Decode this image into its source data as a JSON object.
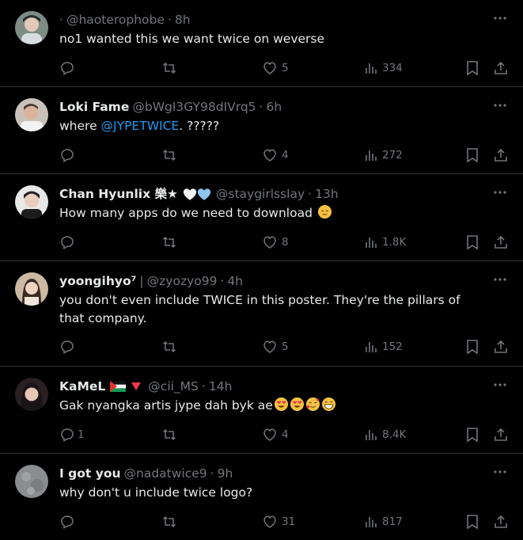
{
  "tweets": [
    {
      "name": "",
      "prefix": "⋅",
      "handle": "@haoterophobe",
      "time": "8h",
      "text": "no1 wanted this we want twice on weverse",
      "replies": "",
      "likes": "5",
      "views": "334"
    },
    {
      "name": "Loki Fame",
      "handle": "@bWgI3GY98dIVrq5",
      "time": "6h",
      "text_before": "where ",
      "mention": "@JYPETWICE",
      "text_after": ". ?????",
      "replies": "",
      "likes": "4",
      "views": "272"
    },
    {
      "name": "Chan Hyunlix 樂★",
      "handle": "@staygirlsslay",
      "time": "13h",
      "text": "How many apps do we need to download",
      "replies": "",
      "likes": "8",
      "views": "1.8K"
    },
    {
      "name": "yoongihyo⁷",
      "separator": "|",
      "handle": "@zyozyo99",
      "time": "4h",
      "text": "you don't even include TWICE in this poster. They're the pillars of that company.",
      "replies": "",
      "likes": "5",
      "views": "152"
    },
    {
      "name": "KaMeL",
      "handle": "@cii_MS",
      "time": "14h",
      "text": "Gak nyangka artis jype dah byk ae",
      "replies": "1",
      "likes": "4",
      "views": "8.4K"
    },
    {
      "name": "I got you",
      "handle": "@nadatwice9",
      "time": "9h",
      "text": "why don't u include twice logo?",
      "replies": "",
      "likes": "31",
      "views": "817"
    }
  ],
  "colors": {
    "background": "#000000",
    "text": "#e7e9ea",
    "muted": "#71767b",
    "link": "#1d9bf0",
    "divider": "#2f3336"
  },
  "icons": [
    "reply-icon",
    "retweet-icon",
    "like-icon",
    "views-icon",
    "bookmark-icon",
    "share-icon",
    "more-icon"
  ]
}
